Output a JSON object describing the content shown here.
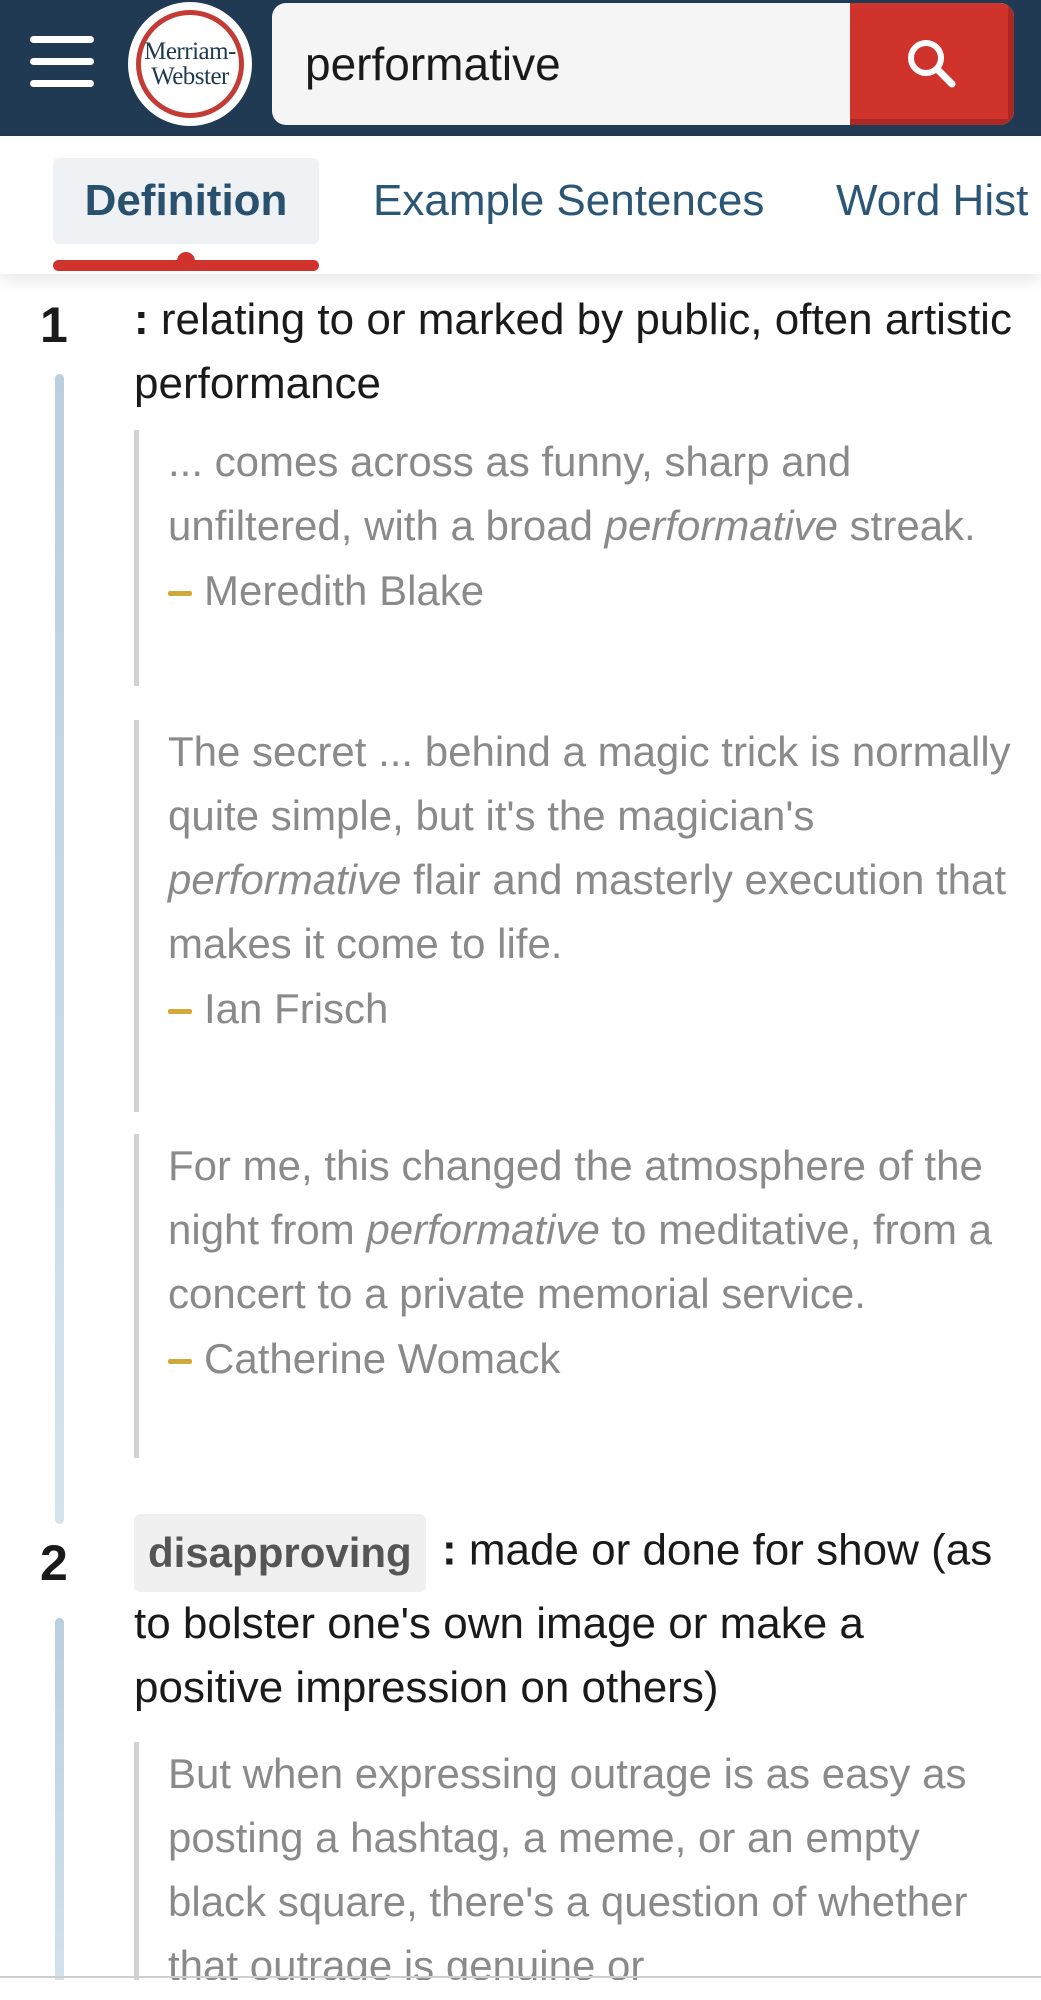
{
  "header": {
    "menu_icon": "hamburger-menu-icon",
    "logo_line1": "Merriam-",
    "logo_line2": "Webster",
    "search_value": "performative",
    "search_icon": "search-icon",
    "colors": {
      "header_bg": "#1f3a52",
      "search_button": "#d0322c",
      "logo_ring": "#c23b35"
    }
  },
  "tabs": [
    {
      "label": "Definition",
      "active": true
    },
    {
      "label": "Example Sentences",
      "active": false
    },
    {
      "label": "Word Hist",
      "active": false
    }
  ],
  "senses": [
    {
      "number": "1",
      "label": "",
      "colon": ":",
      "definition": "relating to or marked by public, often artistic performance",
      "examples": [
        {
          "before": "... comes across as funny, sharp and unfiltered, with a broad ",
          "em": "performative",
          "after": " streak.",
          "author": "Meredith Blake"
        },
        {
          "before": "The secret ... behind a magic trick is normally quite simple, but it's the magician's ",
          "em": "performative",
          "after": " flair and masterly execution that makes it come to life.",
          "author": "Ian Frisch"
        },
        {
          "before": "For me, this changed the atmosphere of the night from ",
          "em": "performative",
          "after": " to meditative, from a concert to a private memorial service.",
          "author": "Catherine Womack"
        }
      ]
    },
    {
      "number": "2",
      "label": "disapproving",
      "colon": ":",
      "definition": "made or done for show (as to bolster one's own image or make a positive impression on others)",
      "examples": [
        {
          "before": "But when expressing outrage is as easy as posting a hashtag, a meme, or an empty black square, there's a question of whether that outrage is genuine or",
          "em": "",
          "after": "",
          "author": ""
        }
      ]
    }
  ]
}
